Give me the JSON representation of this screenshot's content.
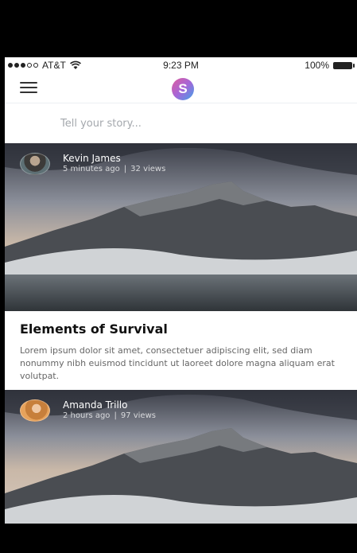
{
  "status_bar": {
    "carrier": "AT&T",
    "time": "9:23 PM",
    "battery": "100%",
    "signal_bars_filled": 3,
    "signal_bars_total": 5
  },
  "nav": {
    "logo_letter": "S",
    "menu_icon": "hamburger-icon",
    "logo_colors": [
      "#e05c9c",
      "#a566d8",
      "#3fa3e8"
    ]
  },
  "compose": {
    "placeholder": "Tell your story..."
  },
  "feed": [
    {
      "author": "Kevin James",
      "time": "5 minutes ago",
      "views": "32 views",
      "title": "Elements of Survival",
      "excerpt": "Lorem ipsum dolor sit amet, consectetuer adipiscing elit, sed diam nonummy nibh euismod tincidunt ut laoreet dolore magna aliquam erat volutpat."
    },
    {
      "author": "Amanda Trillo",
      "time": "2 hours ago",
      "views": "97 views"
    }
  ]
}
